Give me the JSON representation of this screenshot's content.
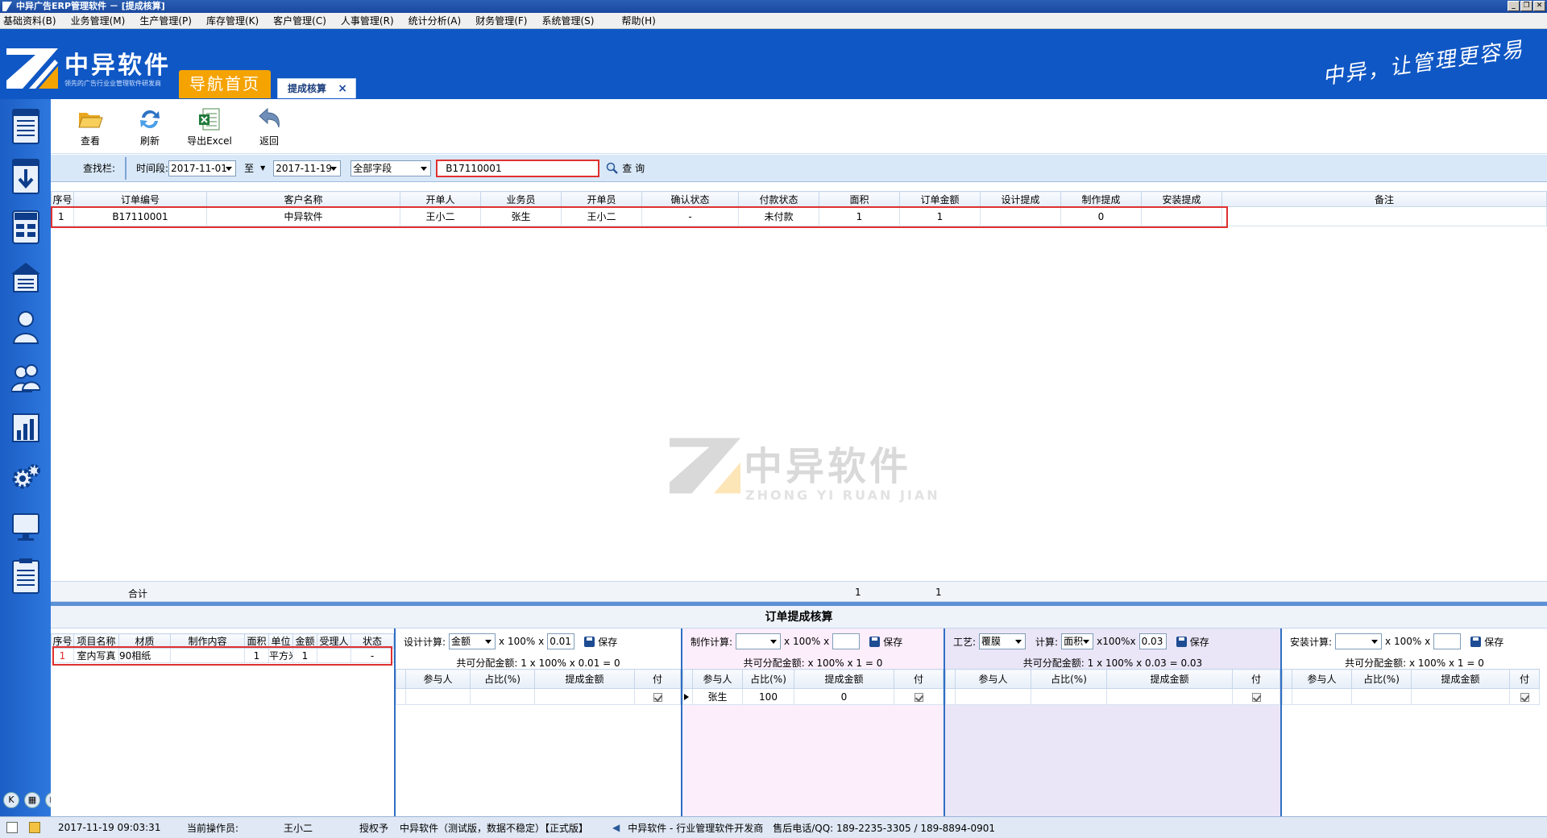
{
  "window": {
    "title": "中异广告ERP管理软件 － [提成核算]"
  },
  "menu": [
    "基础资料(B)",
    "业务管理(M)",
    "生产管理(P)",
    "库存管理(K)",
    "客户管理(C)",
    "人事管理(R)",
    "统计分析(A)",
    "财务管理(F)",
    "系统管理(S)",
    "帮助(H)"
  ],
  "brand": {
    "name": "中异软件",
    "tagline": "领先的广告行业业管理软件研发商",
    "slogan": "中异，让管理更容易"
  },
  "tabs": {
    "home": "导航首页",
    "active": "提成核算",
    "close": "×"
  },
  "toolbar": {
    "view": "查看",
    "refresh": "刷新",
    "export": "导出Excel",
    "back": "返回"
  },
  "filter": {
    "bar_label": "查找栏:",
    "period_label": "时间段:",
    "date_from": "2017-11-01",
    "to_label": "至",
    "date_to": "2017-11-19",
    "field": "全部字段",
    "keyword": "B17110001",
    "search": "查 询"
  },
  "orders": {
    "columns": [
      "序号",
      "订单编号",
      "客户名称",
      "开单人",
      "业务员",
      "开单员",
      "确认状态",
      "付款状态",
      "面积",
      "订单金额",
      "设计提成",
      "制作提成",
      "安装提成",
      "备注"
    ],
    "rows": [
      [
        "1",
        "B17110001",
        "中异软件",
        "王小二",
        "张生",
        "王小二",
        "-",
        "未付款",
        "1",
        "1",
        "",
        "0",
        "",
        ""
      ]
    ],
    "total_label": "合计",
    "total_area": "1",
    "total_amount": "1"
  },
  "watermark": {
    "cn": "中异软件",
    "en": "ZHONG YI RUAN JIAN"
  },
  "panel": {
    "title": "订单提成核算",
    "items": {
      "columns": [
        "序号",
        "项目名称",
        "材质",
        "制作内容",
        "面积",
        "单位",
        "金额",
        "受理人",
        "状态"
      ],
      "rows": [
        [
          "1",
          "室内写真",
          "90相纸",
          "",
          "1",
          "平方米",
          "1",
          "",
          "-"
        ]
      ]
    },
    "design": {
      "label": "设计计算:",
      "basis": "金额",
      "x100": "x 100% x",
      "rate": "0.01",
      "save": "保存",
      "formula": "共可分配金额: 1 x 100% x 0.01 = 0",
      "columns": [
        "参与人",
        "占比(%)",
        "提成金额",
        "付"
      ],
      "rows": []
    },
    "make": {
      "label": "制作计算:",
      "basis": "",
      "x100": "x 100% x",
      "rate": "",
      "save": "保存",
      "formula": "共可分配金额:  x 100% x 1 = 0",
      "columns": [
        "参与人",
        "占比(%)",
        "提成金额",
        "付"
      ],
      "rows": [
        [
          "张生",
          "100",
          "0"
        ]
      ]
    },
    "process": {
      "label": "工艺:",
      "craft": "覆膜",
      "calc_label": "计算:",
      "basis": "面积",
      "x100": "x100%x",
      "rate": "0.03",
      "save": "保存",
      "formula": "共可分配金额: 1 x 100% x 0.03 = 0.03",
      "columns": [
        "参与人",
        "占比(%)",
        "提成金额",
        "付"
      ],
      "rows": []
    },
    "install": {
      "label": "安装计算:",
      "basis": "",
      "x100": "x 100% x",
      "rate": "",
      "save": "保存",
      "formula": "共可分配金额:  x 100% x 1 = 0",
      "columns": [
        "参与人",
        "占比(%)",
        "提成金额",
        "付"
      ],
      "rows": []
    }
  },
  "status": {
    "datetime": "2017-11-19 09:03:31",
    "operator_label": "当前操作员:",
    "operator": "王小二",
    "license_label": "授权予",
    "edition": "中异软件（测试版，数据不稳定）【正式版】",
    "company": "中异软件 - 行业管理软件开发商",
    "contact": "售后电话/QQ: 189-2235-3305  / 189-8894-0901"
  },
  "colors": {
    "brand_blue": "#0f57c4",
    "nav_orange": "#f5a300",
    "highlight_red": "#e03030",
    "sidebar": "#2e78dd"
  }
}
